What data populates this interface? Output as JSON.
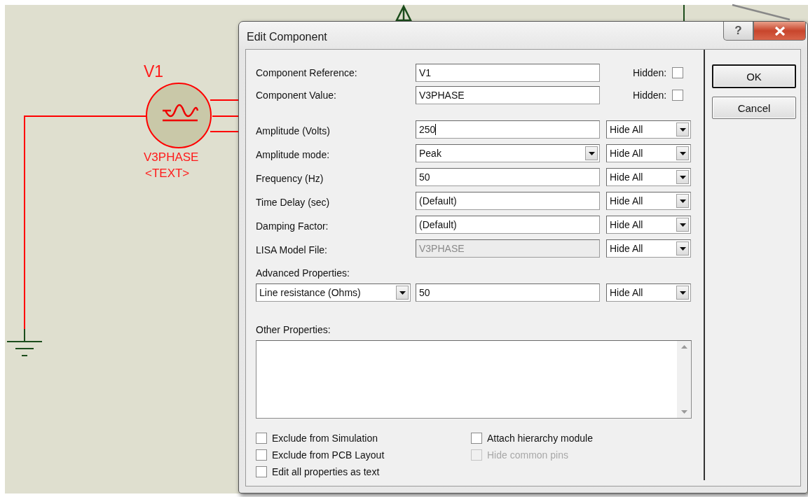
{
  "schematic": {
    "designator": "V1",
    "value": "V3PHASE",
    "text_label": "<TEXT>"
  },
  "dialog": {
    "title": "Edit Component",
    "help_button": "?",
    "header_fields": [
      {
        "label": "Component Reference:",
        "value": "V1",
        "hidden_label": "Hidden:",
        "hidden": false
      },
      {
        "label": "Component Value:",
        "value": "V3PHASE",
        "hidden_label": "Hidden:",
        "hidden": false
      }
    ],
    "properties": [
      {
        "label": "Amplitude (Volts)",
        "kind": "text",
        "value": "250",
        "focused": true,
        "disabled": false,
        "visibility": "Hide All"
      },
      {
        "label": "Amplitude mode:",
        "kind": "select",
        "value": "Peak",
        "focused": false,
        "disabled": false,
        "visibility": "Hide All"
      },
      {
        "label": "Frequency (Hz)",
        "kind": "text",
        "value": "50",
        "focused": false,
        "disabled": false,
        "visibility": "Hide All"
      },
      {
        "label": "Time Delay (sec)",
        "kind": "text",
        "value": "(Default)",
        "focused": false,
        "disabled": false,
        "visibility": "Hide All"
      },
      {
        "label": "Damping Factor:",
        "kind": "text",
        "value": "(Default)",
        "focused": false,
        "disabled": false,
        "visibility": "Hide All"
      },
      {
        "label": "LISA Model File:",
        "kind": "text",
        "value": "V3PHASE",
        "focused": false,
        "disabled": true,
        "visibility": "Hide All"
      }
    ],
    "advanced": {
      "label": "Advanced Properties:",
      "property": "Line resistance (Ohms)",
      "value": "50",
      "visibility": "Hide All"
    },
    "other": {
      "label": "Other Properties:"
    },
    "options": [
      {
        "label": "Exclude from Simulation",
        "checked": false,
        "disabled": false
      },
      {
        "label": "Attach hierarchy module",
        "checked": false,
        "disabled": false
      },
      {
        "label": "Exclude from PCB Layout",
        "checked": false,
        "disabled": false
      },
      {
        "label": "Hide common pins",
        "checked": false,
        "disabled": true
      },
      {
        "label": "Edit all properties as text",
        "checked": false,
        "disabled": false
      }
    ],
    "buttons": [
      {
        "label": "OK",
        "default": true
      },
      {
        "label": "Cancel",
        "default": false
      }
    ]
  }
}
